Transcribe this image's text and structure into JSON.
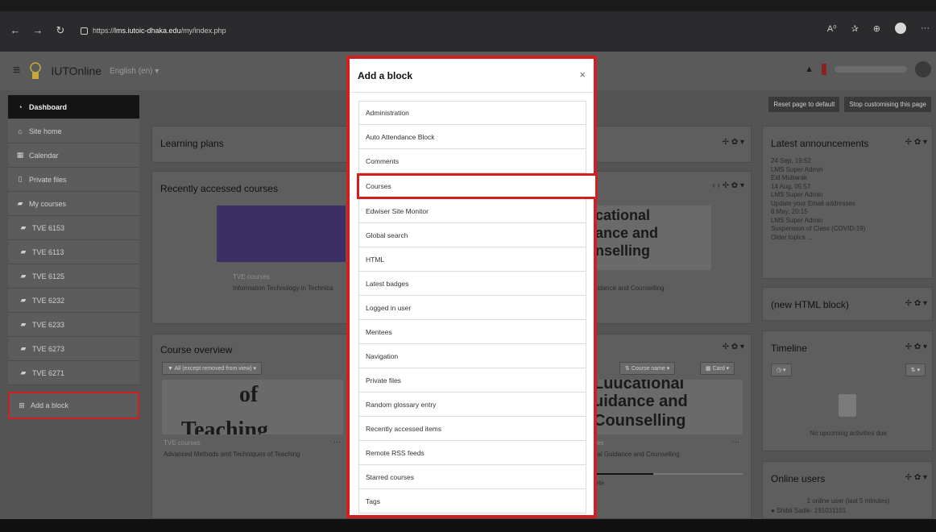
{
  "browser": {
    "url_prefix": "https://",
    "url_host": "lms.iutoic-dhaka.edu",
    "url_path": "/my/index.php"
  },
  "site": {
    "brand": "IUTOnline",
    "language": "English (en) ▾"
  },
  "sidebar": {
    "items": [
      {
        "label": "Dashboard",
        "icon": "dashboard-icon"
      },
      {
        "label": "Site home",
        "icon": "home-icon"
      },
      {
        "label": "Calendar",
        "icon": "calendar-icon"
      },
      {
        "label": "Private files",
        "icon": "file-icon"
      },
      {
        "label": "My courses",
        "icon": "graduation-cap-icon"
      },
      {
        "label": "TVE 6153",
        "icon": "graduation-cap-icon"
      },
      {
        "label": "TVE 6113",
        "icon": "graduation-cap-icon"
      },
      {
        "label": "TVE 6125",
        "icon": "graduation-cap-icon"
      },
      {
        "label": "TVE 6232",
        "icon": "graduation-cap-icon"
      },
      {
        "label": "TVE 6233",
        "icon": "graduation-cap-icon"
      },
      {
        "label": "TVE 6273",
        "icon": "graduation-cap-icon"
      },
      {
        "label": "TVE 6271",
        "icon": "graduation-cap-icon"
      }
    ],
    "add_block": "Add a block"
  },
  "top_buttons": {
    "reset": "Reset page to default",
    "stop": "Stop customising this page"
  },
  "blocks": {
    "learning_plans": "Learning plans",
    "recent_courses": "Recently accessed courses",
    "course_category": "TVE courses",
    "course_name": "Information Technology in Technica",
    "course_right_name": "uidance and Counselling",
    "banner_lines": [
      "cational",
      "ance and",
      "nselling"
    ],
    "course_overview": "Course overview",
    "filter_label": "All (except removed from view) ▾",
    "sort_label": "Course name ▾",
    "view_label": "Card ▾",
    "teaching_big_1": "of",
    "teaching_big_2": "Teaching",
    "co_category": "TVE courses",
    "co_name": "Advanced Methods and Techniques of Teaching",
    "right_banner_lines": [
      "Luucationai",
      "uidance and",
      "Counselling"
    ],
    "co_right_category": "ses",
    "co_right_name": "nal Guidance and Counselling",
    "co_right_status": "lete"
  },
  "announcements": {
    "title": "Latest announcements",
    "lines": [
      "24 Sep, 19:52",
      "LMS Super Admin",
      "Eid Mubarak",
      "14 Aug, 05:57",
      "LMS Super Admin",
      "Update your Email addresses",
      "8 May, 20:15",
      "LMS Super Admin",
      "Suspension of Class (COVID-19)",
      "Older topics ..."
    ]
  },
  "html_block": {
    "title": "(new HTML block)"
  },
  "timeline": {
    "title": "Timeline",
    "empty": "No upcoming activities due"
  },
  "online_users": {
    "title": "Online users",
    "summary": "1 online user (last 5 minutes)",
    "user": "Shibli Sadik- 191031101"
  },
  "modal": {
    "title": "Add a block",
    "close": "×",
    "items": [
      "Administration",
      "Auto Attendance Block",
      "Comments",
      "Courses",
      "Edwiser Site Monitor",
      "Global search",
      "HTML",
      "Latest badges",
      "Logged in user",
      "Mentees",
      "Navigation",
      "Private files",
      "Random glossary entry",
      "Recently accessed items",
      "Remote RSS feeds",
      "Starred courses",
      "Tags"
    ],
    "highlighted_index": 3
  },
  "colors": {
    "highlight": "#d21f1f",
    "overlay": "#545454"
  }
}
